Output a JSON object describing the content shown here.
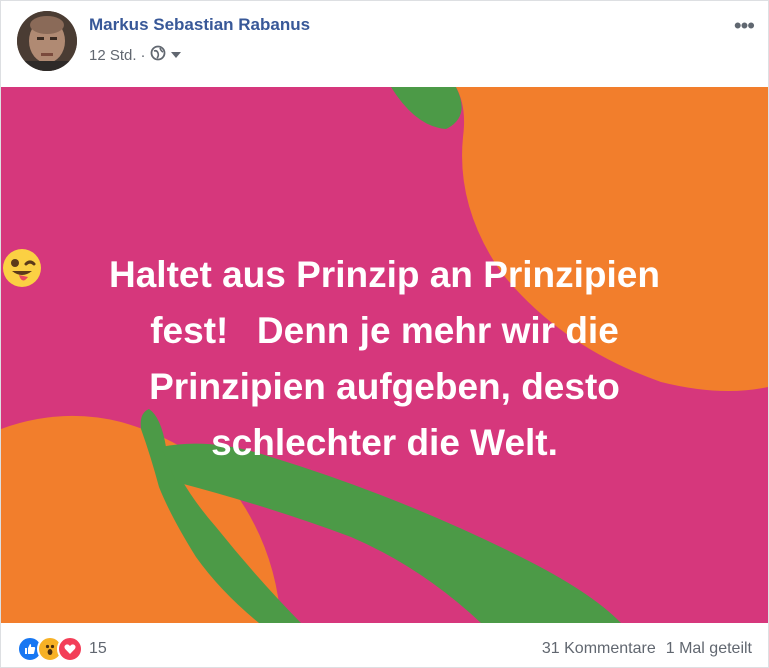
{
  "post": {
    "author": "Markus Sebastian Rabanus",
    "timestamp": "12 Std.",
    "separator": "·",
    "privacy_icon": "globe-icon",
    "audience_dropdown_icon": "caret-down-icon",
    "more_icon": "more-options-icon",
    "more_label": "•••",
    "text_lines": [
      "Haltet aus Prinzip an Prinzipien",
      "fest!",
      "Denn je mehr wir die",
      "Prinzipien aufgeben, desto",
      "schlechter die Welt."
    ],
    "emoji": "winking-face-with-tongue",
    "background": {
      "base": "#d6377c",
      "orange": "#f27e2c",
      "green": "#4c9a47"
    }
  },
  "footer": {
    "reaction_icons": [
      "like-icon",
      "wow-icon",
      "love-icon"
    ],
    "reaction_count": "15",
    "comments": "31 Kommentare",
    "shares": "1 Mal geteilt"
  },
  "colors": {
    "link": "#385898",
    "meta": "#616770",
    "like": "#1877f2",
    "love": "#f33e58",
    "wow": "#f7b125"
  }
}
